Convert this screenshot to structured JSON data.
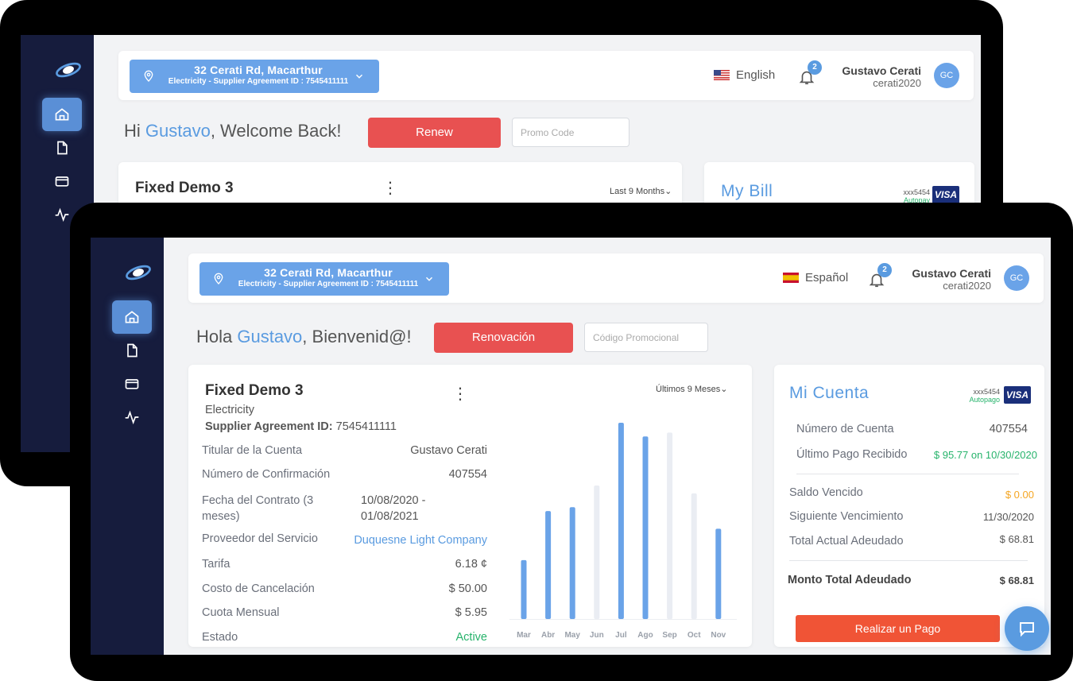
{
  "back": {
    "address_line1": "32 Cerati Rd, Macarthur",
    "address_line2": "Electricity - Supplier Agreement ID : 7545411111",
    "language": "English",
    "notifications": "2",
    "user_name": "Gustavo Cerati",
    "user_id": "cerati2020",
    "avatar_initials": "GC",
    "greeting_prefix": "Hi ",
    "greeting_name": "Gustavo",
    "greeting_suffix": ", Welcome Back!",
    "renew_label": "Renew",
    "promo_placeholder": "Promo Code",
    "plan_title": "Fixed Demo 3",
    "period": "Last 9 Months",
    "bill_title": "My Bill",
    "card_last": "xxx5454",
    "autopay": "Autopay",
    "visa": "VISA"
  },
  "front": {
    "address_line1": "32 Cerati Rd, Macarthur",
    "address_line2": "Electricity - Supplier Agreement ID : 7545411111",
    "language": "Español",
    "notifications": "2",
    "user_name": "Gustavo Cerati",
    "user_id": "cerati2020",
    "avatar_initials": "GC",
    "greeting_prefix": "Hola ",
    "greeting_name": "Gustavo",
    "greeting_suffix": ", Bienvenid@!",
    "renew_label": "Renovación",
    "promo_placeholder": "Código Promocional",
    "plan": {
      "title": "Fixed Demo 3",
      "type": "Electricity",
      "agreement_label": "Supplier Agreement ID:",
      "agreement_id": "7545411111",
      "period": "Últimos 9 Meses",
      "rows": [
        {
          "label": "Titular de la Cuenta",
          "value": "Gustavo Cerati"
        },
        {
          "label": "Número de Confirmación",
          "value": "407554"
        },
        {
          "label": "Fecha del Contrato (3 meses)",
          "value": "10/08/2020 - 01/08/2021"
        },
        {
          "label": "Proveedor del Servicio",
          "value": "Duquesne Light Company"
        },
        {
          "label": "Tarifa",
          "value": "6.18 ¢"
        },
        {
          "label": "Costo de Cancelación",
          "value": "$ 50.00"
        },
        {
          "label": "Cuota Mensual",
          "value": "$ 5.95"
        },
        {
          "label": "Estado",
          "value": "Active"
        }
      ]
    },
    "bill": {
      "title": "Mi Cuenta",
      "card_last": "xxx5454",
      "autopay": "Autopago",
      "visa": "VISA",
      "account_number_label": "Número de Cuenta",
      "account_number": "407554",
      "last_payment_label": "Último Pago Recibido",
      "last_payment": "$ 95.77 on 10/30/2020",
      "past_due_label": "Saldo Vencido",
      "past_due": "$ 0.00",
      "next_due_label": "Siguiente Vencimiento",
      "next_due": "11/30/2020",
      "current_total_label": "Total Actual Adeudado",
      "current_total": "$ 68.81",
      "total_label": "Monto Total Adeudado",
      "total": "$ 68.81",
      "pay_label": "Realizar un Pago"
    }
  },
  "colors": {
    "sidebar": "#161c3d",
    "accent": "#5a9be0",
    "renew": "#e85151",
    "pay": "#f05436",
    "active_green": "#26b36b",
    "past_due_orange": "#f5a623",
    "bar_used": "#6aa3e8",
    "bar_forecast": "#eaedf3"
  },
  "chart_data": {
    "type": "bar",
    "categories": [
      "Mar",
      "Abr",
      "May",
      "Jun",
      "Jul",
      "Ago",
      "Sep",
      "Oct",
      "Nov"
    ],
    "series": [
      {
        "values": [
          30,
          55,
          57,
          0,
          100,
          93,
          0,
          0,
          46
        ]
      },
      {
        "values": [
          0,
          0,
          0,
          68,
          0,
          0,
          95,
          64,
          0
        ]
      }
    ],
    "ylim": [
      0,
      100
    ],
    "title": "",
    "xlabel": "",
    "ylabel": ""
  }
}
